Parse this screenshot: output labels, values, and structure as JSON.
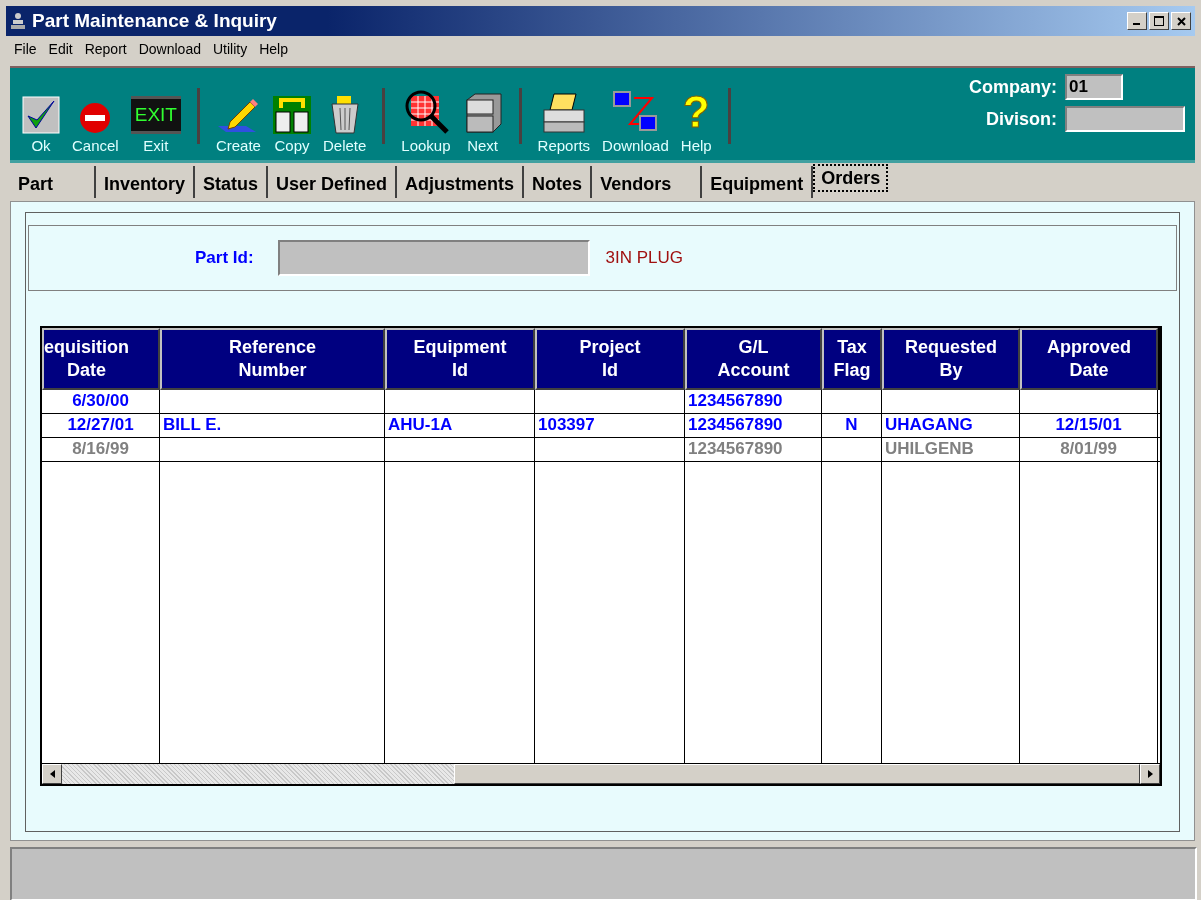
{
  "window": {
    "title": "Part Maintenance & Inquiry"
  },
  "menu": [
    "File",
    "Edit",
    "Report",
    "Download",
    "Utility",
    "Help"
  ],
  "toolbar": [
    {
      "label": "Ok",
      "kind": "ok"
    },
    {
      "label": "Cancel",
      "kind": "cancel"
    },
    {
      "label": "Exit",
      "kind": "exit",
      "sign": "EXIT"
    },
    {
      "kind": "sep"
    },
    {
      "label": "Create",
      "kind": "create"
    },
    {
      "label": "Copy",
      "kind": "copy"
    },
    {
      "label": "Delete",
      "kind": "delete"
    },
    {
      "kind": "sep"
    },
    {
      "label": "Lookup",
      "kind": "lookup"
    },
    {
      "label": "Next",
      "kind": "next"
    },
    {
      "kind": "sep"
    },
    {
      "label": "Reports",
      "kind": "reports"
    },
    {
      "label": "Download",
      "kind": "download"
    },
    {
      "label": "Help",
      "kind": "help",
      "sign": "?"
    },
    {
      "kind": "sep"
    }
  ],
  "company": {
    "label": "Company:",
    "value": "01"
  },
  "division": {
    "label": "Divison:"
  },
  "tabs": [
    {
      "label": "Part",
      "selected": false
    },
    {
      "label": "Inventory",
      "selected": false
    },
    {
      "label": "Status",
      "selected": false
    },
    {
      "label": "User Defined",
      "selected": false
    },
    {
      "label": "Adjustments",
      "selected": false
    },
    {
      "label": "Notes",
      "selected": false
    },
    {
      "label": "Vendors",
      "selected": false
    },
    {
      "label": "Equipment",
      "selected": false
    },
    {
      "label": "Orders",
      "selected": true
    }
  ],
  "part": {
    "label": "Part Id:",
    "description": "3IN PLUG"
  },
  "table": {
    "columns": [
      "equisition\nDate",
      "Reference\nNumber",
      "Equipment\nId",
      "Project\nId",
      "G/L\nAccount",
      "Tax\nFlag",
      "Requested\nBy",
      "Approved\nDate"
    ],
    "rows": [
      {
        "disabled": false,
        "cells": [
          "6/30/00",
          "",
          "",
          "",
          "1234567890",
          "",
          "",
          ""
        ]
      },
      {
        "disabled": false,
        "cells": [
          "12/27/01",
          "BILL E.",
          "AHU-1A",
          "103397",
          "1234567890",
          "N",
          "UHAGANG",
          "12/15/01"
        ]
      },
      {
        "disabled": true,
        "cells": [
          "8/16/99",
          "",
          "",
          "",
          "1234567890",
          "",
          "UHILGENB",
          "8/01/99"
        ]
      }
    ]
  }
}
